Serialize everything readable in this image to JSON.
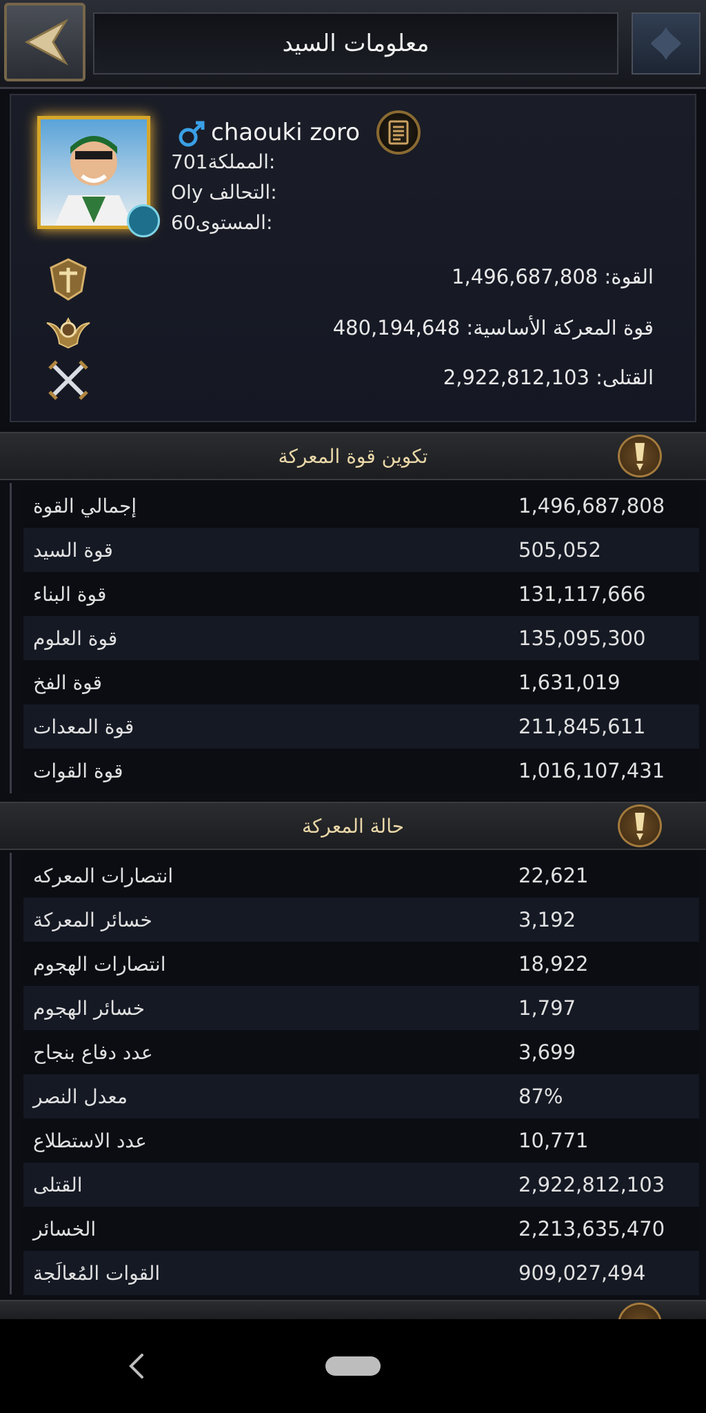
{
  "header": {
    "title": "معلومات السيد"
  },
  "profile": {
    "name": "chaouki zoro",
    "kingdom_label": "المملكة:",
    "kingdom_value": "701",
    "alliance_label": "التحالف:",
    "alliance_value": "Oly",
    "level_label": "المستوى:",
    "level_value": "60",
    "power_label": "القوة:",
    "power_value": "1,496,687,808",
    "base_power_label": "قوة المعركة الأساسية:",
    "base_power_value": "480,194,648",
    "kills_label": "القتلى:",
    "kills_value": "2,922,812,103"
  },
  "sections": {
    "power_composition": {
      "title": "تكوين قوة المعركة",
      "rows": [
        {
          "label": "إجمالي القوة",
          "value": "1,496,687,808"
        },
        {
          "label": "قوة السيد",
          "value": "505,052"
        },
        {
          "label": "قوة البناء",
          "value": "131,117,666"
        },
        {
          "label": "قوة العلوم",
          "value": "135,095,300"
        },
        {
          "label": "قوة الفخ",
          "value": "1,631,019"
        },
        {
          "label": "قوة المعدات",
          "value": "211,845,611"
        },
        {
          "label": "قوة القوات",
          "value": "1,016,107,431"
        }
      ]
    },
    "battle_status": {
      "title": "حالة المعركة",
      "rows": [
        {
          "label": "انتصارات المعركه",
          "value": "22,621"
        },
        {
          "label": "خسائر المعركة",
          "value": "3,192"
        },
        {
          "label": "انتصارات الهجوم",
          "value": "18,922"
        },
        {
          "label": "خسائر الهجوم",
          "value": "1,797"
        },
        {
          "label": "عدد دفاع بنجاح",
          "value": "3,699"
        },
        {
          "label": "معدل النصر",
          "value": "87%"
        },
        {
          "label": "عدد الاستطلاع",
          "value": "10,771"
        },
        {
          "label": "القتلى",
          "value": "2,922,812,103"
        },
        {
          "label": "الخسائر",
          "value": "2,213,635,470"
        },
        {
          "label": "القوات المُعالَجة",
          "value": "909,027,494"
        }
      ]
    }
  },
  "colors": {
    "gold": "#d7a72a",
    "section_title": "#e9d7a8",
    "male_icon": "#3aa0e6"
  },
  "icons": [
    "back-arrow-icon",
    "emblem-icon",
    "male-icon",
    "notes-icon",
    "power-icon",
    "base-power-icon",
    "crossed-swords-icon",
    "sort-icon"
  ]
}
